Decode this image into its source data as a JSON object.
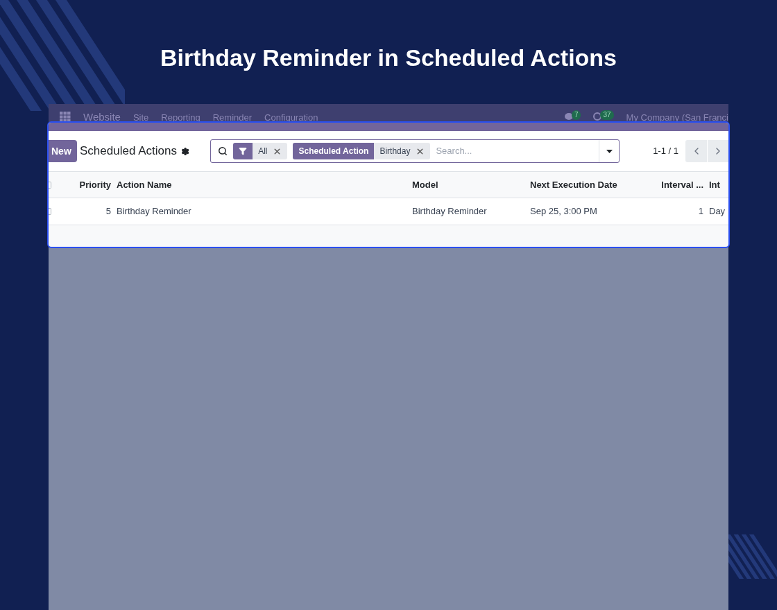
{
  "title": "Birthday Reminder in Scheduled Actions",
  "navbar": {
    "menu": [
      "Website",
      "Site",
      "Reporting",
      "Reminder",
      "Configuration"
    ],
    "badges": [
      {
        "kind": "chat",
        "count": "7"
      },
      {
        "kind": "activity",
        "count": "37"
      }
    ],
    "company": "My Company (San Franci"
  },
  "control_panel": {
    "new_button": "New",
    "breadcrumb": "Scheduled Actions",
    "facets": [
      {
        "kind": "filter",
        "values": [
          "All"
        ]
      },
      {
        "kind": "group",
        "label": "Scheduled Action",
        "values": [
          "Birthday"
        ]
      }
    ],
    "search": {
      "placeholder": "Search..."
    },
    "pager": "1-1 / 1"
  },
  "table": {
    "all_selected": false,
    "columns": [
      {
        "label": "Priority",
        "kind": "number"
      },
      {
        "label": "Action Name",
        "kind": "text"
      },
      {
        "label": "Model",
        "kind": "text"
      },
      {
        "label": "Next Execution Date",
        "kind": "text"
      },
      {
        "label": "Interval ...",
        "kind": "number"
      },
      {
        "label": "Int",
        "kind": "text"
      }
    ],
    "rows": [
      {
        "selected": false,
        "cells": [
          "5",
          "Birthday Reminder",
          "Birthday Reminder",
          "Sep 25, 3:00 PM",
          "1",
          "Day"
        ]
      }
    ]
  }
}
